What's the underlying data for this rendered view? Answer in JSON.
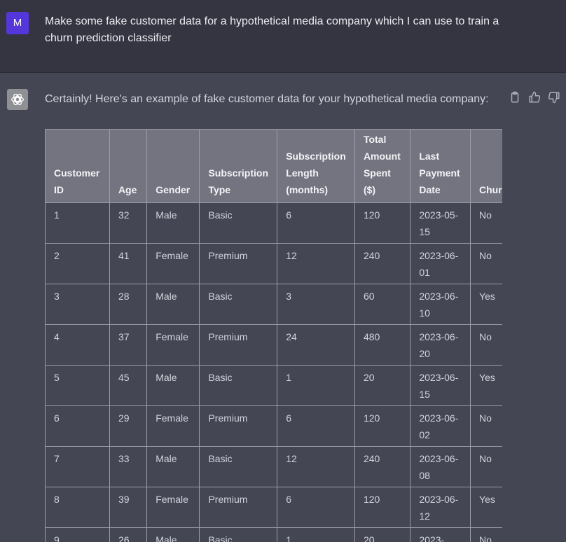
{
  "user": {
    "avatar_letter": "M",
    "avatar_color": "#5436da",
    "message": "Make some fake customer data for a hypothetical media company which I can use to train a churn prediction classifier"
  },
  "assistant": {
    "avatar_icon": "openai-logo-icon",
    "intro": "Certainly! Here's an example of fake customer data for your hypothetical media company:",
    "actions": [
      "clipboard-icon",
      "thumbs-up-icon",
      "thumbs-down-icon"
    ]
  },
  "table": {
    "headers": [
      "Customer ID",
      "Age",
      "Gender",
      "Subscription Type",
      "Subscription Length (months)",
      "Total Amount Spent ($)",
      "Last Payment Date",
      "Churned"
    ],
    "rows": [
      [
        "1",
        "32",
        "Male",
        "Basic",
        "6",
        "120",
        "2023-05-15",
        "No"
      ],
      [
        "2",
        "41",
        "Female",
        "Premium",
        "12",
        "240",
        "2023-06-01",
        "No"
      ],
      [
        "3",
        "28",
        "Male",
        "Basic",
        "3",
        "60",
        "2023-06-10",
        "Yes"
      ],
      [
        "4",
        "37",
        "Female",
        "Premium",
        "24",
        "480",
        "2023-06-20",
        "No"
      ],
      [
        "5",
        "45",
        "Male",
        "Basic",
        "1",
        "20",
        "2023-06-15",
        "Yes"
      ],
      [
        "6",
        "29",
        "Female",
        "Premium",
        "6",
        "120",
        "2023-06-02",
        "No"
      ],
      [
        "7",
        "33",
        "Male",
        "Basic",
        "12",
        "240",
        "2023-06-08",
        "No"
      ],
      [
        "8",
        "39",
        "Female",
        "Premium",
        "6",
        "120",
        "2023-06-12",
        "Yes"
      ],
      [
        "9",
        "26",
        "Male",
        "Basic",
        "1",
        "20",
        "2023-",
        "No"
      ]
    ]
  }
}
